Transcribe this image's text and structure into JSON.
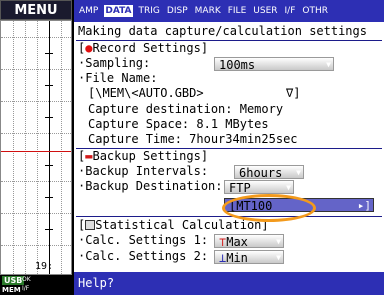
{
  "menu_label": "MENU",
  "tabs": [
    {
      "label": "AMP",
      "active": false
    },
    {
      "label": "DATA",
      "active": true
    },
    {
      "label": "TRIG",
      "active": false
    },
    {
      "label": "DISP",
      "active": false
    },
    {
      "label": "MARK",
      "active": false
    },
    {
      "label": "FILE",
      "active": false
    },
    {
      "label": "USER",
      "active": false
    },
    {
      "label": "I/F",
      "active": false
    },
    {
      "label": "OTHR",
      "active": false
    }
  ],
  "side": {
    "time_label": "19:",
    "usb_label": "USB",
    "mem_label": "MEM",
    "small_top": "OK",
    "small_bottom": "I/F"
  },
  "main": {
    "title": "Making data capture/calculation settings",
    "record": {
      "header": "Record Settings]",
      "sampling_label": "·Sampling:",
      "sampling_value": "100ms",
      "file_name_label": "·File Name:",
      "file_name_value": "[\\MEM\\<AUTO.GBD>",
      "file_name_end": "∇]",
      "capture_dest": "Capture destination: Memory",
      "capture_space": "Capture Space:    8.1 MBytes",
      "capture_time": "Capture Time:   7hour34min25sec"
    },
    "backup": {
      "header": "Backup Settings]",
      "intervals_label": "·Backup Intervals:",
      "intervals_value": "6hours",
      "dest_label": "·Backup Destination:",
      "dest_value": "FTP",
      "path_value": "[MT100",
      "path_end": "▸]"
    },
    "stat": {
      "header": "Statistical Calculation]",
      "calc1_label": "·Calc. Settings 1:",
      "calc1_value": "Max",
      "calc2_label": "·Calc. Settings 2:",
      "calc2_value": "Min"
    }
  },
  "help_text": "Help?",
  "icons": {
    "dropdown": "triangle-down",
    "record": "red-dot",
    "backup": "backup-icon",
    "stat": "calc-icon",
    "max": "max-icon",
    "min": "min-icon"
  },
  "colors": {
    "tabbar_bg": "#2d2fb4",
    "help_bg": "#2d2fb4",
    "highlight_bg": "#6464c8",
    "ring": "#f39a1c",
    "record_dot": "#e01010"
  }
}
